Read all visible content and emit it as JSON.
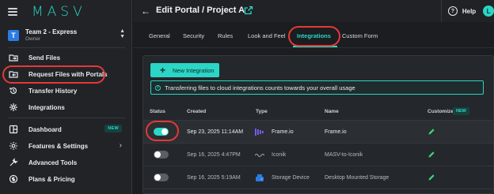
{
  "brand": {
    "name": "MASV"
  },
  "team": {
    "initial": "T",
    "name": "Team 2 - Express",
    "role": "Owner"
  },
  "sidebar": {
    "items": [
      {
        "label": "Send Files",
        "icon": "send-files-icon"
      },
      {
        "label": "Request Files with Portals",
        "icon": "portal-request-icon"
      },
      {
        "label": "Transfer History",
        "icon": "history-icon"
      },
      {
        "label": "Integrations",
        "icon": "integrations-icon"
      },
      {
        "label": "Dashboard",
        "icon": "dashboard-icon",
        "badge": "NEW"
      },
      {
        "label": "Features & Settings",
        "icon": "gear-icon"
      },
      {
        "label": "Advanced Tools",
        "icon": "tools-icon"
      },
      {
        "label": "Plans & Pricing",
        "icon": "pricing-icon"
      }
    ]
  },
  "header": {
    "title": "Edit Portal / Project A",
    "help_label": "Help",
    "user_initial": "L"
  },
  "tabs": [
    {
      "label": "General"
    },
    {
      "label": "Security"
    },
    {
      "label": "Rules"
    },
    {
      "label": "Look and Feel"
    },
    {
      "label": "Integrations",
      "active": true
    },
    {
      "label": "Custom Form"
    }
  ],
  "main": {
    "new_integration_label": "New Integration",
    "banner_text": "Transferring files to cloud integrations counts towards your overall usage",
    "table": {
      "columns": [
        "Status",
        "Created",
        "Type",
        "Name",
        "Customize"
      ],
      "customize_badge": "NEW",
      "rows": [
        {
          "enabled": true,
          "created": "Sep 23, 2025 11:14AM",
          "type": "Frame.io",
          "type_icon": "frameio-icon",
          "name": "Frame.io"
        },
        {
          "enabled": false,
          "created": "Sep 16, 2025 4:47PM",
          "type": "Iconik",
          "type_icon": "iconik-icon",
          "name": "MASV-to-Iconik"
        },
        {
          "enabled": false,
          "created": "Sep 16, 2025 5:19AM",
          "type": "Storage Device",
          "type_icon": "storage-device-icon",
          "name": "Desktop Mounted Storage"
        }
      ]
    }
  },
  "colors": {
    "accent": "#2bd6c6",
    "highlight": "#e53935",
    "background": "#1b1d21",
    "sidebar": "#212327"
  }
}
